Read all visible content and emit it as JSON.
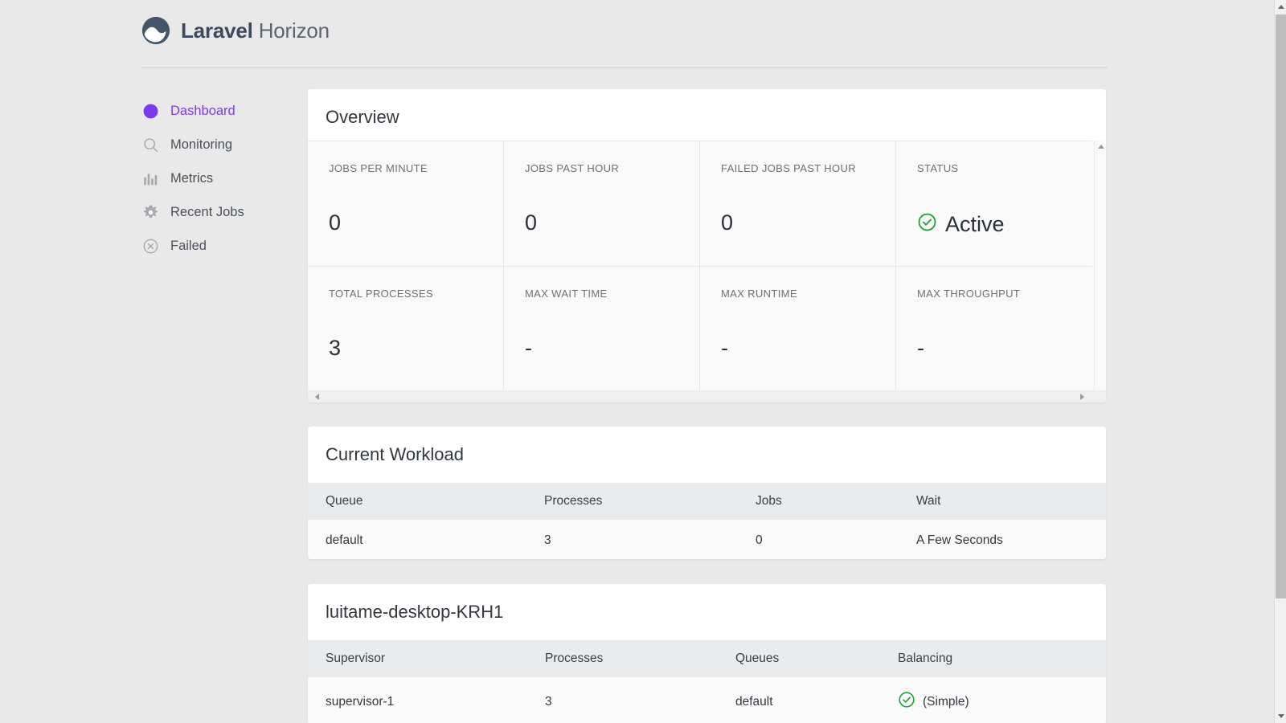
{
  "brand": {
    "name_bold": "Laravel",
    "name_light": "Horizon",
    "logo_icon": "horizon-logo-icon",
    "logo_color": "#44546a"
  },
  "sidebar": {
    "items": [
      {
        "label": "Dashboard",
        "icon": "gauge-icon",
        "active": true
      },
      {
        "label": "Monitoring",
        "icon": "search-icon",
        "active": false
      },
      {
        "label": "Metrics",
        "icon": "bar-chart-icon",
        "active": false
      },
      {
        "label": "Recent Jobs",
        "icon": "gear-icon",
        "active": false
      },
      {
        "label": "Failed",
        "icon": "circle-x-icon",
        "active": false
      }
    ],
    "active_color": "#7c3aed"
  },
  "overview": {
    "title": "Overview",
    "stats": [
      {
        "label": "JOBS PER MINUTE",
        "value": "0",
        "icon": null
      },
      {
        "label": "JOBS PAST HOUR",
        "value": "0",
        "icon": null
      },
      {
        "label": "FAILED JOBS PAST HOUR",
        "value": "0",
        "icon": null
      },
      {
        "label": "STATUS",
        "value": "Active",
        "icon": "circle-check-icon",
        "icon_color": "#27a03b"
      },
      {
        "label": "TOTAL PROCESSES",
        "value": "3",
        "icon": null
      },
      {
        "label": "MAX WAIT TIME",
        "value": "-",
        "icon": null
      },
      {
        "label": "MAX RUNTIME",
        "value": "-",
        "icon": null
      },
      {
        "label": "MAX THROUGHPUT",
        "value": "-",
        "icon": null
      }
    ]
  },
  "workload": {
    "title": "Current Workload",
    "columns": [
      "Queue",
      "Processes",
      "Jobs",
      "Wait"
    ],
    "rows": [
      {
        "queue": "default",
        "processes": "3",
        "jobs": "0",
        "wait": "A Few Seconds"
      }
    ]
  },
  "supervisor": {
    "title": "luitame-desktop-KRH1",
    "columns": [
      "Supervisor",
      "Processes",
      "Queues",
      "Balancing"
    ],
    "rows": [
      {
        "supervisor": "supervisor-1",
        "processes": "3",
        "queues": "default",
        "balancing": "(Simple)",
        "balancing_icon": "circle-check-icon",
        "balancing_icon_color": "#27a03b"
      }
    ]
  },
  "scrollbars": {
    "overview_vertical": {
      "up_icon": "triangle-up-icon",
      "down_icon": "triangle-down-icon"
    },
    "overview_horizontal": {
      "left_icon": "triangle-left-icon",
      "right_icon": "triangle-right-icon"
    },
    "browser_vertical": {
      "up_icon": "triangle-up-icon",
      "down_icon": "triangle-down-icon"
    }
  }
}
